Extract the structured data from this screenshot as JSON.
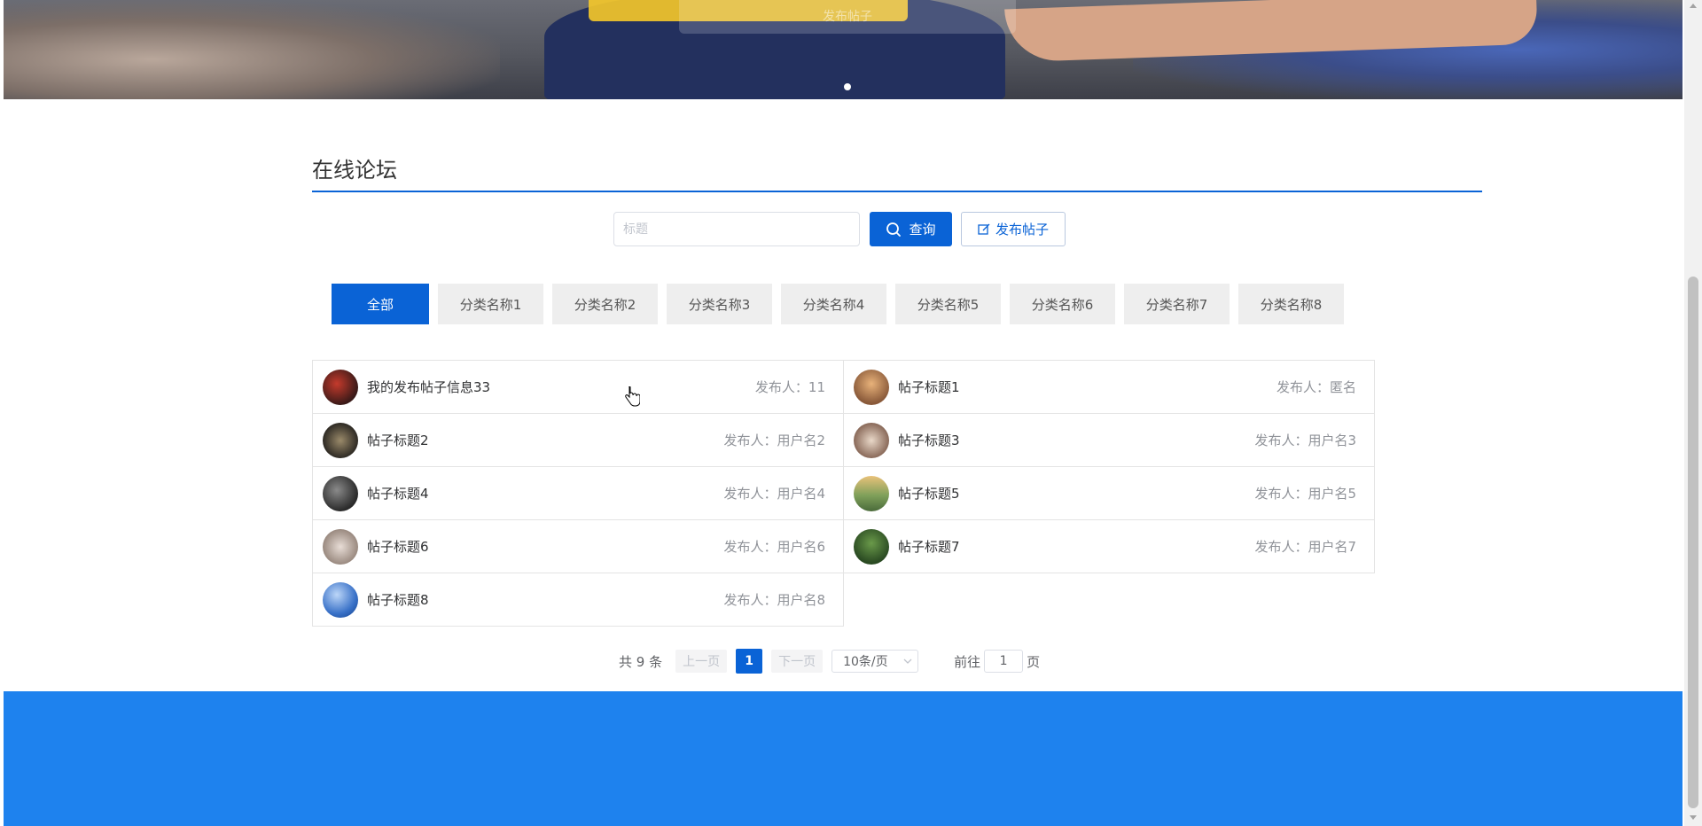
{
  "banner": {
    "caption": "发布帖子"
  },
  "section": {
    "title": "在线论坛"
  },
  "search": {
    "placeholder": "标题",
    "value": "",
    "query_label": "查询",
    "publish_label": "发布帖子"
  },
  "tabs": [
    {
      "label": "全部",
      "active": true
    },
    {
      "label": "分类名称1"
    },
    {
      "label": "分类名称2"
    },
    {
      "label": "分类名称3"
    },
    {
      "label": "分类名称4"
    },
    {
      "label": "分类名称5"
    },
    {
      "label": "分类名称6"
    },
    {
      "label": "分类名称7"
    },
    {
      "label": "分类名称8"
    }
  ],
  "posts": [
    {
      "title": "我的发布帖子信息33",
      "author": "发布人：11"
    },
    {
      "title": "帖子标题1",
      "author": "发布人：匿名"
    },
    {
      "title": "帖子标题2",
      "author": "发布人：用户名2"
    },
    {
      "title": "帖子标题3",
      "author": "发布人：用户名3"
    },
    {
      "title": "帖子标题4",
      "author": "发布人：用户名4"
    },
    {
      "title": "帖子标题5",
      "author": "发布人：用户名5"
    },
    {
      "title": "帖子标题6",
      "author": "发布人：用户名6"
    },
    {
      "title": "帖子标题7",
      "author": "发布人：用户名7"
    },
    {
      "title": "帖子标题8",
      "author": "发布人：用户名8"
    }
  ],
  "pagination": {
    "total": "共 9 条",
    "prev": "上一页",
    "current": "1",
    "next": "下一页",
    "page_size": "10条/页",
    "goto_label": "前往",
    "goto_value": "1",
    "page_suffix": "页"
  },
  "colors": {
    "primary": "#0a63d6",
    "footer": "#1e82ee"
  }
}
